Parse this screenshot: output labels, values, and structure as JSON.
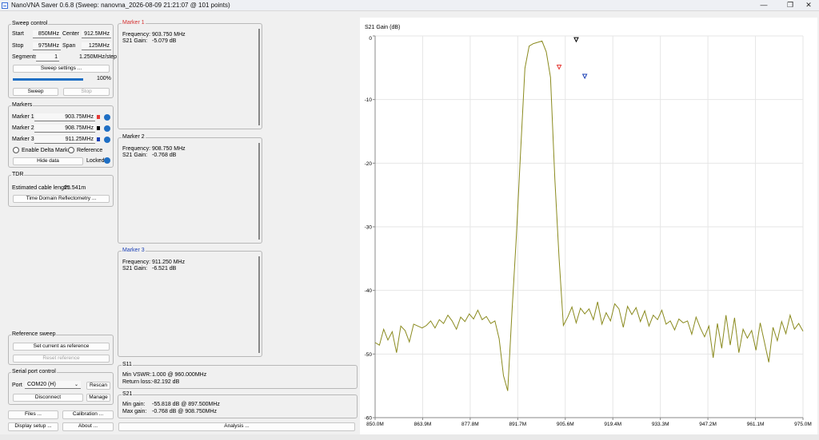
{
  "window": {
    "title": "NanoVNA Saver 0.6.8 (Sweep: nanovna_2026-08-09 21:21:07 @ 101 points)",
    "minimize": "—",
    "maximize": "❐",
    "close": "✕"
  },
  "sweep_control": {
    "title": "Sweep control",
    "start_label": "Start",
    "start_value": "850MHz",
    "center_label": "Center",
    "center_value": "912.5MHz",
    "stop_label": "Stop",
    "stop_value": "975MHz",
    "span_label": "Span",
    "span_value": "125MHz",
    "segments_label": "Segments",
    "segments_value": "1",
    "step_text": "1.250MHz/step",
    "settings_button": "Sweep settings ...",
    "progress_text": "100%",
    "progress_fraction": 1.0,
    "sweep_button": "Sweep",
    "stop_button": "Stop"
  },
  "markers_panel": {
    "title": "Markers",
    "items": [
      {
        "label": "Marker 1",
        "value": "903.75MHz",
        "color": "#e53935"
      },
      {
        "label": "Marker 2",
        "value": "908.75MHz",
        "color": "#000000"
      },
      {
        "label": "Marker 3",
        "value": "911.25MHz",
        "color": "#1a3fb5"
      }
    ],
    "delta_label": "Enable Delta Marker",
    "reference_label": "Reference",
    "hide_button": "Hide data",
    "locked_label": "Locked"
  },
  "tdr": {
    "title": "TDR",
    "cable_label": "Estimated cable length:",
    "cable_value": "25.541m",
    "button": "Time Domain Reflectometry ..."
  },
  "reference_sweep": {
    "title": "Reference sweep",
    "set_button": "Set current as reference",
    "reset_button": "Reset reference"
  },
  "serial": {
    "title": "Serial port control",
    "port_label": "Port",
    "port_value": "COM20 (H)",
    "rescan_button": "Rescan",
    "disconnect_button": "Disconnect",
    "manage_button": "Manage"
  },
  "bottom_buttons": {
    "files": "Files ...",
    "calibration": "Calibration ...",
    "display": "Display setup ...",
    "about": "About ...",
    "analysis": "Analysis ..."
  },
  "marker_boxes": [
    {
      "title": "Marker 1",
      "title_color": "#d32f2f",
      "freq_label": "Frequency:",
      "freq_value": "903.750 MHz",
      "gain_label": "S21 Gain:",
      "gain_value": "-5.079 dB"
    },
    {
      "title": "Marker 2",
      "title_color": "#000000",
      "freq_label": "Frequency:",
      "freq_value": "908.750 MHz",
      "gain_label": "S21 Gain:",
      "gain_value": "-0.768 dB"
    },
    {
      "title": "Marker 3",
      "title_color": "#1a3fb5",
      "freq_label": "Frequency:",
      "freq_value": "911.250 MHz",
      "gain_label": "S21 Gain:",
      "gain_value": "-6.521 dB"
    }
  ],
  "s11_box": {
    "title": "S11",
    "line1_label": "Min VSWR:",
    "line1_value": "1.000 @ 960.000MHz",
    "line2_label": "Return loss:",
    "line2_value": "-82.192 dB"
  },
  "s21_box": {
    "title": "S21",
    "line1_label": "Min gain:",
    "line1_value": "-55.818 dB @ 897.500MHz",
    "line2_label": "Max gain:",
    "line2_value": "-0.768 dB @ 908.750MHz"
  },
  "chart_data": {
    "type": "line",
    "title": "S21 Gain (dB)",
    "xlabel": "",
    "ylabel": "",
    "xlim": [
      850.0,
      975.0
    ],
    "ylim": [
      -60,
      0
    ],
    "x_ticks": [
      "850.0M",
      "863.9M",
      "877.8M",
      "891.7M",
      "905.6M",
      "919.4M",
      "933.3M",
      "947.2M",
      "961.1M",
      "975.0M"
    ],
    "y_ticks": [
      0,
      -10,
      -20,
      -30,
      -40,
      -50,
      -60
    ],
    "grid": true,
    "line_color": "#8a8a1e",
    "series": [
      {
        "values": [
          -48.2,
          -48.6,
          -46.1,
          -47.8,
          -46.5,
          -49.8,
          -45.6,
          -46.3,
          -48.1,
          -45.3,
          -45.6,
          -45.9,
          -45.5,
          -44.8,
          -45.9,
          -44.6,
          -45.2,
          -43.9,
          -44.8,
          -46.1,
          -44.2,
          -44.9,
          -43.7,
          -44.5,
          -43.1,
          -44.6,
          -44.1,
          -45.2,
          -44.8,
          -47.6,
          -53.4,
          -55.8,
          -43.2,
          -31.5,
          -18.2,
          -5.1,
          -1.6,
          -1.2,
          -1.0,
          -0.8,
          -2.5,
          -6.5,
          -22.4,
          -34.9,
          -45.5,
          -44.2,
          -42.6,
          -45.1,
          -42.8,
          -43.7,
          -42.9,
          -44.6,
          -41.8,
          -45.3,
          -43.5,
          -44.8,
          -42.1,
          -42.9,
          -45.8,
          -42.5,
          -43.8,
          -42.7,
          -44.9,
          -43.2,
          -45.6,
          -43.9,
          -44.6,
          -43.1,
          -45.3,
          -44.8,
          -46.2,
          -44.5,
          -45.1,
          -44.8,
          -46.9,
          -44.2,
          -45.9,
          -47.3,
          -45.6,
          -50.6,
          -45.2,
          -49.1,
          -43.9,
          -48.6,
          -44.3,
          -49.8,
          -46.1,
          -47.5,
          -46.3,
          -49.4,
          -45.1,
          -48.2,
          -51.3,
          -45.8,
          -47.9,
          -44.9,
          -46.8,
          -43.9,
          -46.1,
          -45.2,
          -46.4
        ]
      }
    ],
    "markers": [
      {
        "name": "Marker 1",
        "x": 903.75,
        "y": -5.079,
        "color": "#e53935"
      },
      {
        "name": "Marker 2",
        "x": 908.75,
        "y": -0.768,
        "color": "#000000"
      },
      {
        "name": "Marker 3",
        "x": 911.25,
        "y": -6.521,
        "color": "#1a3fb5"
      }
    ]
  }
}
